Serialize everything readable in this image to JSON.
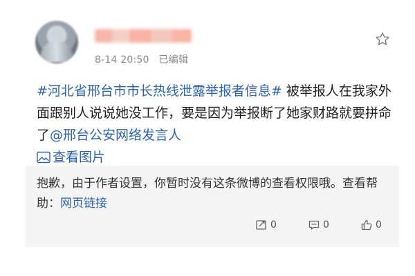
{
  "post": {
    "timestamp": "8-14 20:50",
    "edited_label": "已编辑",
    "hashtag": "#河北省邢台市市长热线泄露举报者信息#",
    "body_text": " 被举报人在我家外面跟别人说说她没工作，要是因为举报断了她家财路就要拼命了",
    "mention": "@邢台公安网络发言人",
    "view_image_label": "查看图片"
  },
  "notice": {
    "text": "抱歉，由于作者设置，你暂时没有这条微博的查看权限哦。查看帮助：",
    "help_link": "网页链接"
  },
  "actions": {
    "repost_count": "0",
    "comment_count": "0",
    "like_count": "0"
  },
  "colors": {
    "link": "#2d63a8",
    "meta": "#8a8a8a",
    "notice_bg": "#f4f4f4"
  }
}
